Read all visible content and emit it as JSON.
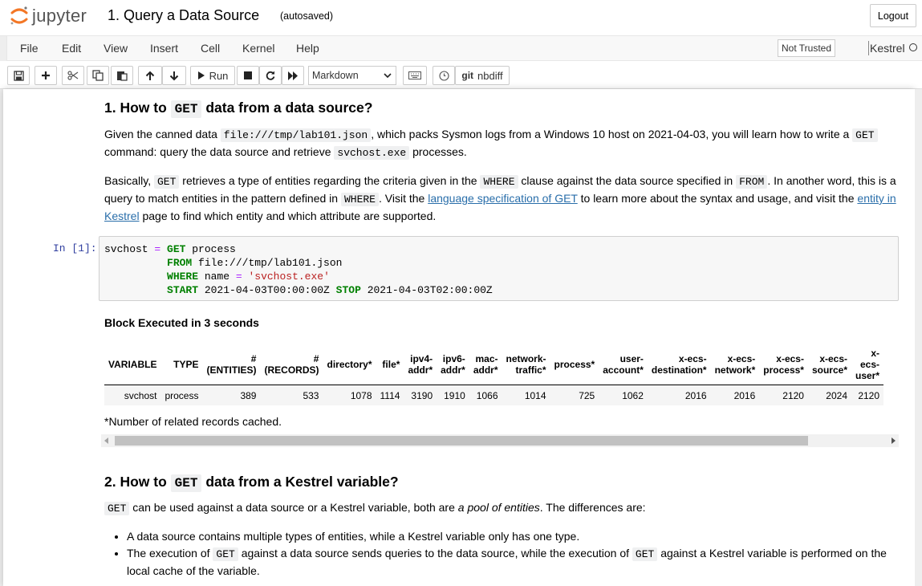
{
  "header": {
    "logo_text": "jupyter",
    "notebook_title": "1. Query a Data Source",
    "autosave_status": "(autosaved)",
    "logout_label": "Logout"
  },
  "menubar": {
    "items": [
      "File",
      "Edit",
      "View",
      "Insert",
      "Cell",
      "Kernel",
      "Help"
    ],
    "trusted_label": "Not Trusted",
    "kernel_name": "Kestrel"
  },
  "toolbar": {
    "run_label": "Run",
    "cell_type": "Markdown",
    "nbdiff_label": "nbdiff",
    "git_label": "git",
    "icons": [
      "save-icon",
      "add-icon",
      "cut-icon",
      "copy-icon",
      "paste-icon",
      "move-up-icon",
      "move-down-icon",
      "run-icon",
      "stop-icon",
      "restart-icon",
      "fast-forward-icon",
      "keyboard-icon",
      "history-icon"
    ]
  },
  "cells": {
    "section1": {
      "heading_pre": "1. How to ",
      "heading_code": "GET",
      "heading_post": " data from a data source?",
      "p1_a": "Given the canned data ",
      "p1_code1": "file:///tmp/lab101.json",
      "p1_b": ", which packs Sysmon logs from a Windows 10 host on 2021-04-03, you will learn how to write a ",
      "p1_code2": "GET",
      "p1_c": " command: query the data source and retrieve ",
      "p1_code3": "svchost.exe",
      "p1_d": " processes.",
      "p2_a": "Basically, ",
      "p2_code1": "GET",
      "p2_b": " retrieves a type of entities regarding the criteria given in the ",
      "p2_code2": "WHERE",
      "p2_c": " clause against the data source specified in ",
      "p2_code3": "FROM",
      "p2_d": ". In another word, this is a query to match entities in the pattern defined in ",
      "p2_code4": "WHERE",
      "p2_e": ". Visit the ",
      "p2_link1": "language specification of GET",
      "p2_f": " to learn more about the syntax and usage, and visit the ",
      "p2_link2": "entity in Kestrel",
      "p2_g": " page to find which entity and which attribute are supported."
    },
    "code_cell": {
      "prompt": "In [1]:",
      "line1_var": "svchost",
      "line1_op": "=",
      "line1_kw": "GET",
      "line1_rest": " process",
      "line2_kw": "FROM",
      "line2_rest": " file:///tmp/lab101.json",
      "line3_kw": "WHERE",
      "line3_mid": " name ",
      "line3_op": "=",
      "line3_str": "'svchost.exe'",
      "line4_kw1": "START",
      "line4_mid": " 2021-04-03T00:00:00Z ",
      "line4_kw2": "STOP",
      "line4_rest": " 2021-04-03T02:00:00Z"
    },
    "output": {
      "title": "Block Executed in 3 seconds",
      "columns": [
        [
          "VARIABLE"
        ],
        [
          "TYPE"
        ],
        [
          "#",
          "(ENTITIES)"
        ],
        [
          "#",
          "(RECORDS)"
        ],
        [
          "directory*"
        ],
        [
          "file*"
        ],
        [
          "ipv4-",
          "addr*"
        ],
        [
          "ipv6-",
          "addr*"
        ],
        [
          "mac-",
          "addr*"
        ],
        [
          "network-",
          "traffic*"
        ],
        [
          "process*"
        ],
        [
          "user-",
          "account*"
        ],
        [
          "x-ecs-",
          "destination*"
        ],
        [
          "x-ecs-",
          "network*"
        ],
        [
          "x-ecs-",
          "process*"
        ],
        [
          "x-ecs-",
          "source*"
        ],
        [
          "x-",
          "ecs-",
          "user*"
        ]
      ],
      "row": [
        "svchost",
        "process",
        "389",
        "533",
        "1078",
        "1114",
        "3190",
        "1910",
        "1066",
        "1014",
        "725",
        "1062",
        "2016",
        "2016",
        "2120",
        "2024",
        "2120"
      ],
      "note": "*Number of related records cached."
    },
    "section2": {
      "heading_pre": "2. How to ",
      "heading_code": "GET",
      "heading_post": " data from a Kestrel variable?",
      "p1_code": "GET",
      "p1_a": " can be used against a data source or a Kestrel variable, both are ",
      "p1_em": "a pool of entities",
      "p1_b": ". The differences are:",
      "li1": "A data source contains multiple types of entities, while a Kestrel variable only has one type.",
      "li2_a": "The execution of ",
      "li2_code1": "GET",
      "li2_b": " against a data source sends queries to the data source, while the execution of ",
      "li2_code2": "GET",
      "li2_c": " against a Kestrel variable is performed on the local cache of the variable."
    }
  },
  "colors": {
    "logo_orange": "#f37726",
    "prompt_blue": "#303f9f",
    "keyword_green": "#008000",
    "string_red": "#ba2121",
    "operator_purple": "#aa22ff",
    "link_blue": "#296eaa"
  }
}
